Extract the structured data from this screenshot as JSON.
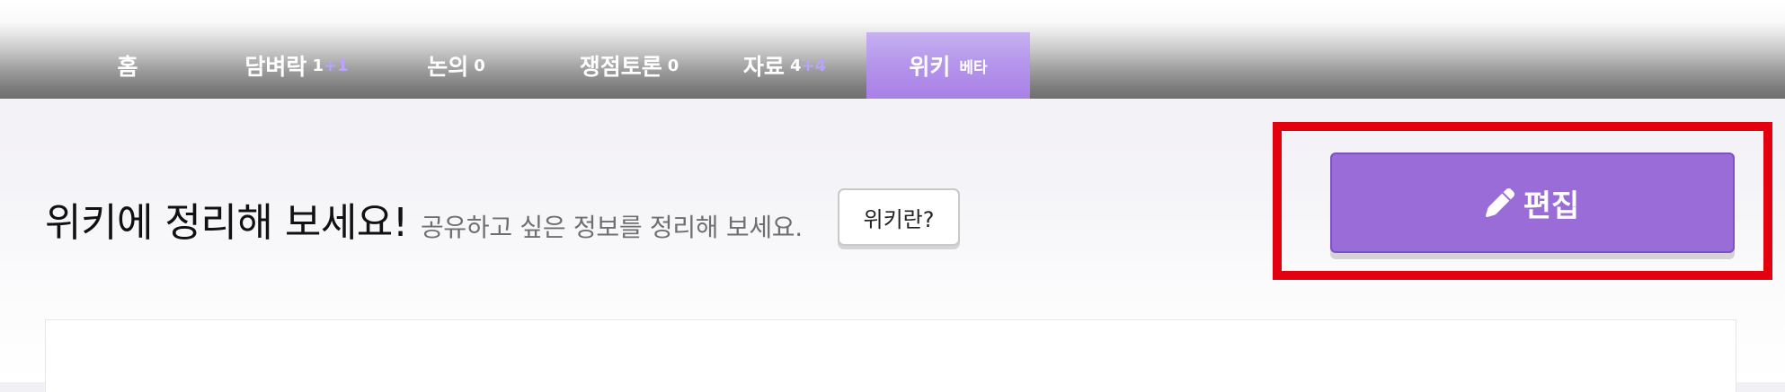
{
  "nav": {
    "home": {
      "label": "홈"
    },
    "banter": {
      "label": "담벼락",
      "count": "1",
      "new": "+1"
    },
    "discuss": {
      "label": "논의",
      "count": "0"
    },
    "debate": {
      "label": "쟁점토론",
      "count": "0"
    },
    "data": {
      "label": "자료",
      "count": "4",
      "new": "+4"
    },
    "wiki": {
      "label": "위키",
      "badge": "베타"
    }
  },
  "main": {
    "title": "위키에 정리해 보세요!",
    "subtitle": "공유하고 싶은 정보를 정리해 보세요.",
    "what_button": "위키란?",
    "edit_button": "편집",
    "edit_icon": "pencil-icon"
  },
  "colors": {
    "accent": "#9a6cd7",
    "active_tab": "#b596ec",
    "new_count": "#b9a3ff",
    "highlight": "#e3000f"
  }
}
